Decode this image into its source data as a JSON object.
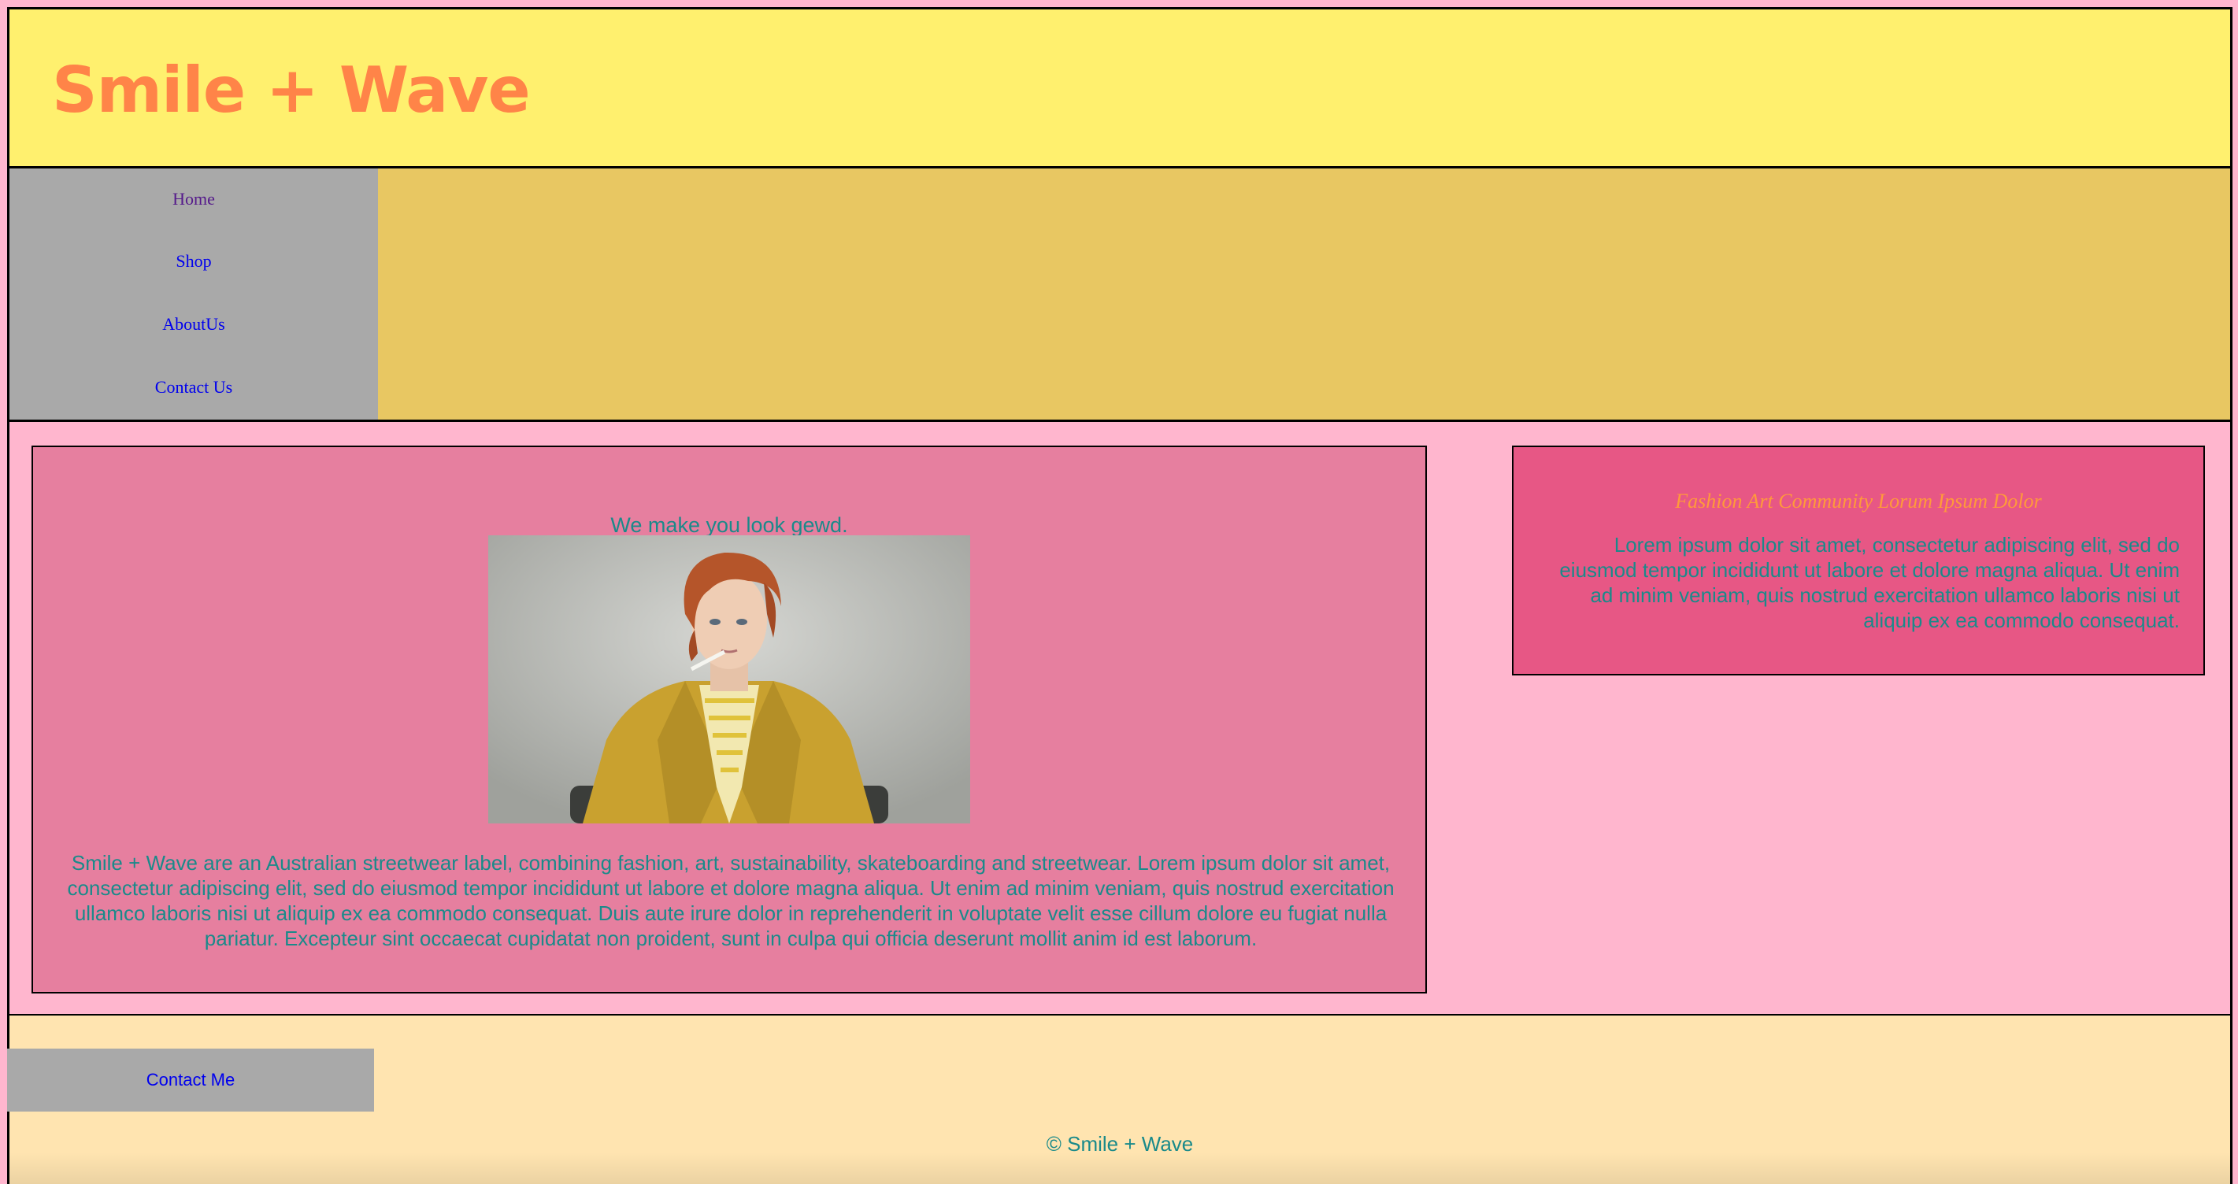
{
  "header": {
    "title": "Smile + Wave"
  },
  "nav": {
    "items": [
      {
        "label": "Home"
      },
      {
        "label": "Shop"
      },
      {
        "label": "AboutUs"
      },
      {
        "label": "Contact Us"
      }
    ]
  },
  "main": {
    "tagline": "We make you look gewd.",
    "photo_icon": "portrait-photo-icon",
    "about": "Smile + Wave are an Australian streetwear label, combining fashion, art, sustainability, skateboarding and streetwear. Lorem ipsum dolor sit amet, consectetur adipiscing elit, sed do eiusmod tempor incididunt ut labore et dolore magna aliqua. Ut enim ad minim veniam, quis nostrud exercitation ullamco laboris nisi ut aliquip ex ea commodo consequat. Duis aute irure dolor in reprehenderit in voluptate velit esse cillum dolore eu fugiat nulla pariatur. Excepteur sint occaecat cupidatat non proident, sunt in culpa qui officia deserunt mollit anim id est laborum."
  },
  "aside": {
    "title": "Fashion Art Community Lorum Ipsum Dolor",
    "text": "Lorem ipsum dolor sit amet, consectetur adipiscing elit, sed do eiusmod tempor incididunt ut labore et dolore magna aliqua. Ut enim ad minim veniam, quis nostrud exercitation ullamco laboris nisi ut aliquip ex ea commodo consequat."
  },
  "footer": {
    "contact_label": "Contact Me",
    "copyright": "© Smile + Wave"
  },
  "colors": {
    "header_bg": "#fff06e",
    "title": "#ff8448",
    "nav_band_bg": "#e8c762",
    "nav_bg": "#a9a9a9",
    "page_bg": "#ffb6ce",
    "article_bg": "#e67f9f",
    "aside_bg": "#e75785",
    "footer_bg": "#ffe4b0",
    "text_teal": "#1a8a8a",
    "aside_title": "#ff9a3a",
    "link": "#0000ee",
    "link_visited": "#551a8b"
  }
}
